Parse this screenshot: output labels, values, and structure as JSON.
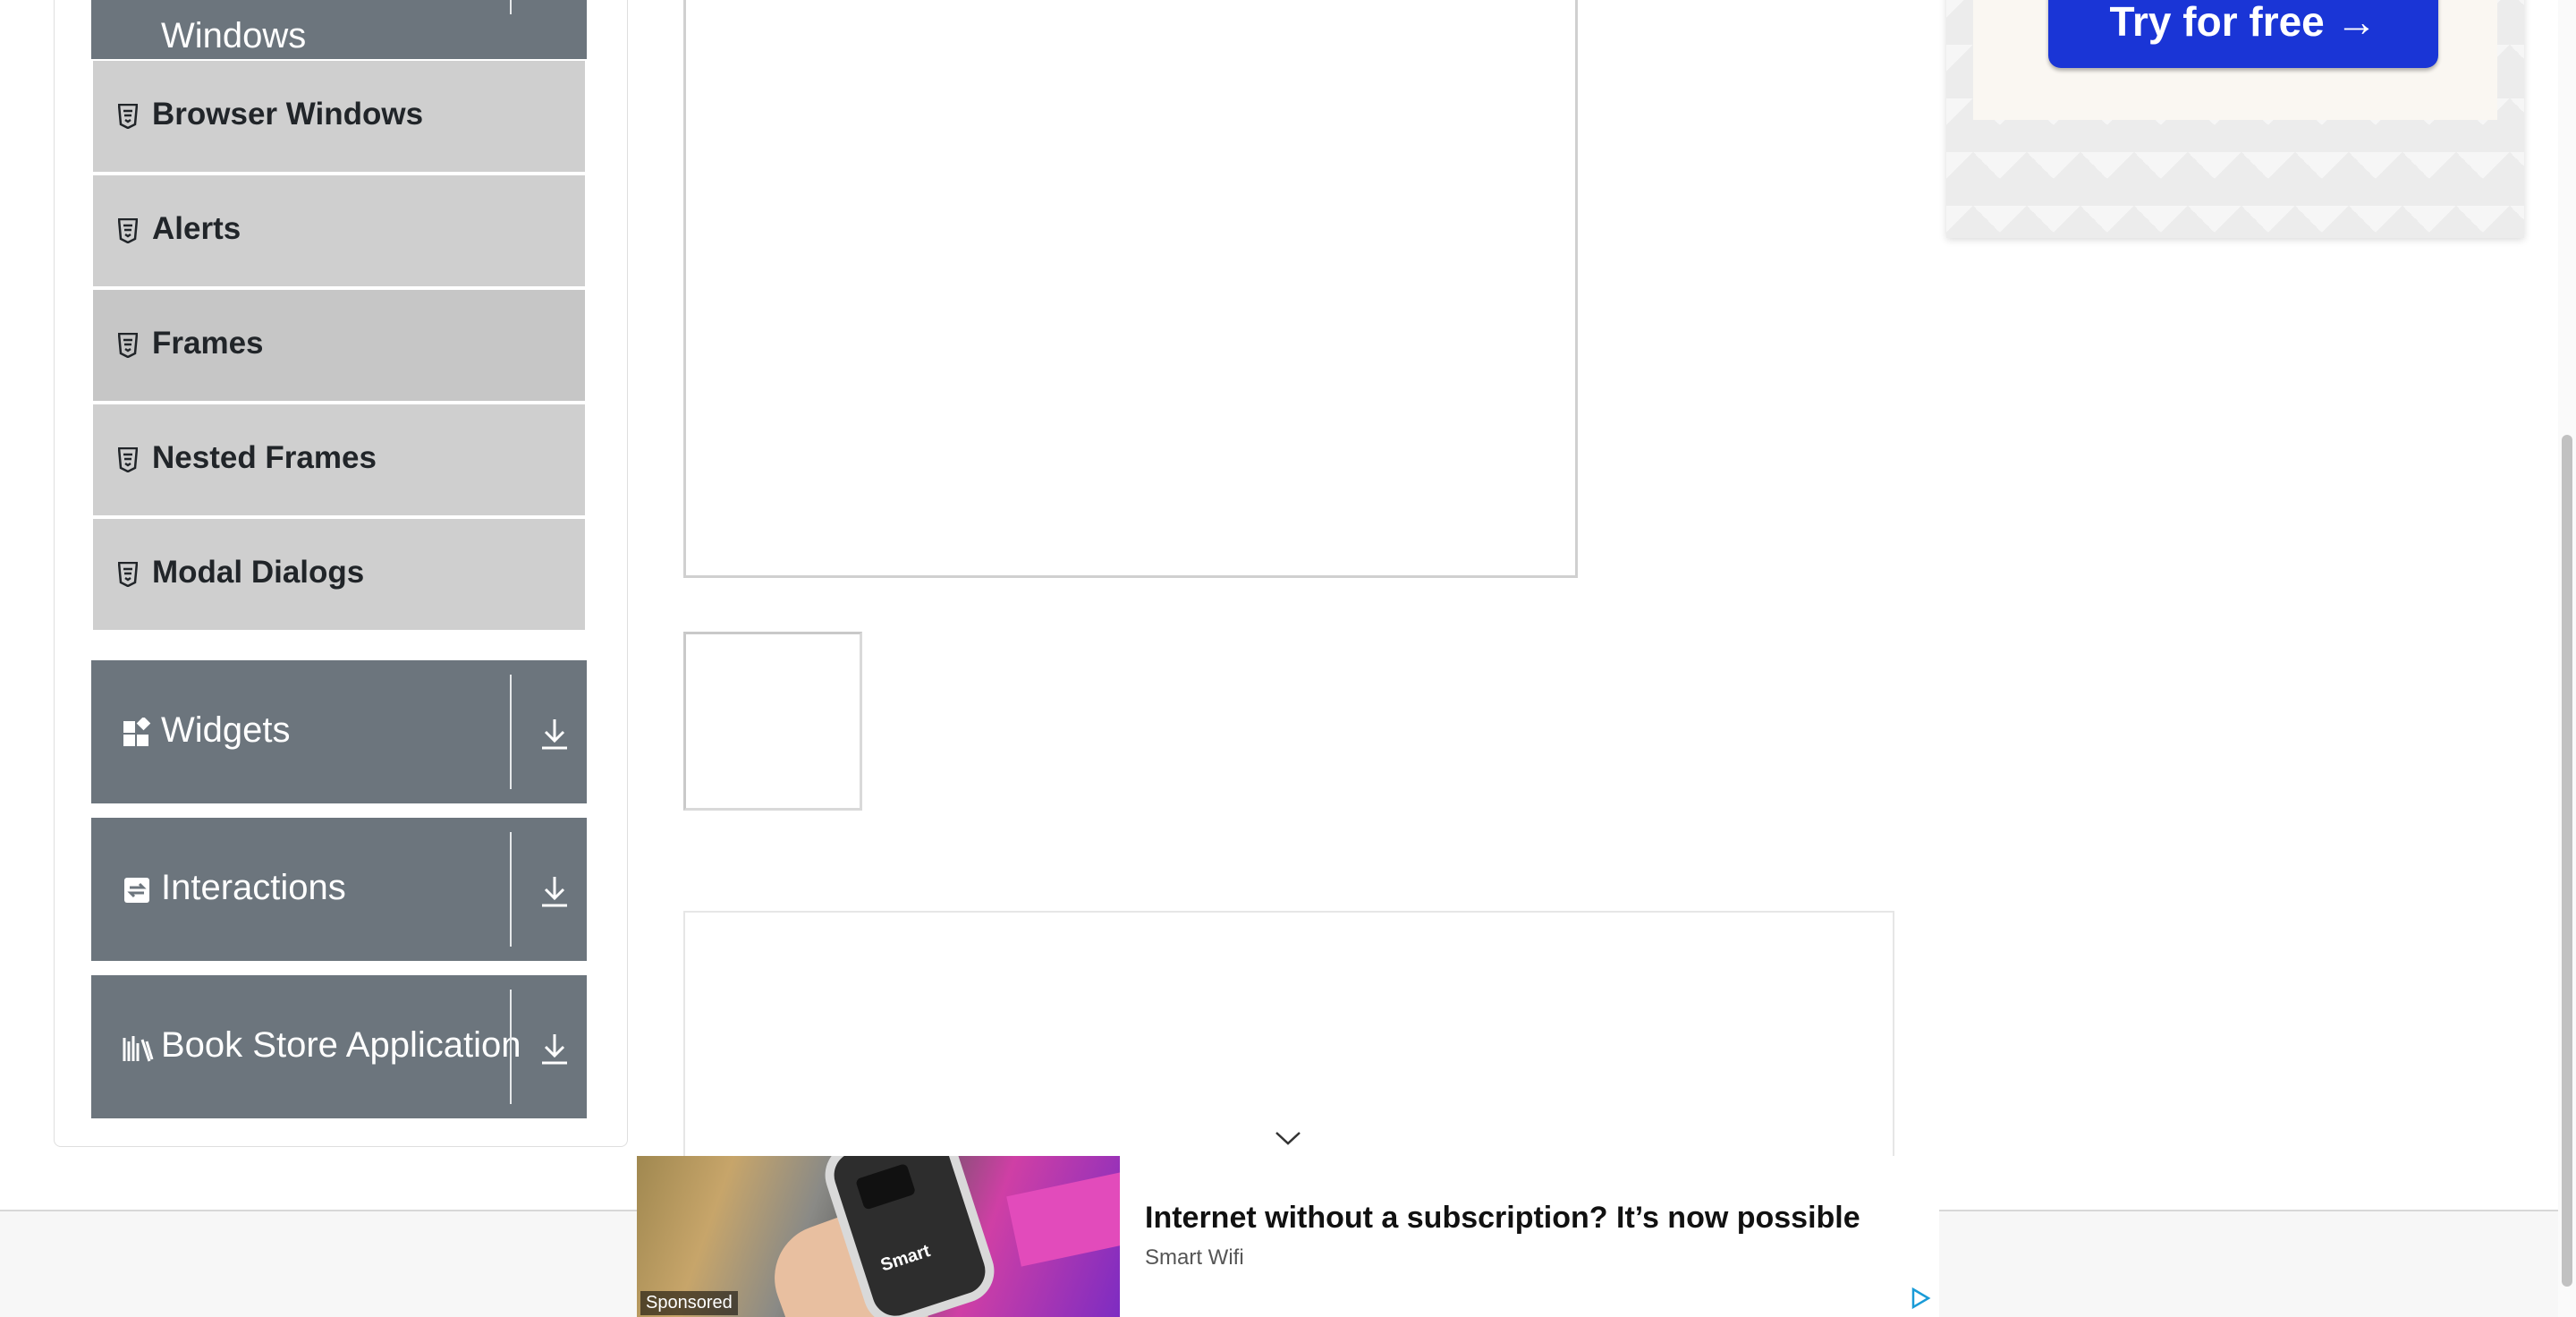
{
  "sidebar": {
    "top_group": {
      "label": "Windows"
    },
    "items": [
      {
        "label": "Browser Windows",
        "active": false
      },
      {
        "label": "Alerts",
        "active": false
      },
      {
        "label": "Frames",
        "active": true
      },
      {
        "label": "Nested Frames",
        "active": false
      },
      {
        "label": "Modal Dialogs",
        "active": false
      }
    ],
    "groups": [
      {
        "label": "Widgets",
        "icon": "widgets-icon"
      },
      {
        "label": "Interactions",
        "icon": "interactions-icon"
      },
      {
        "label": "Book Store Application",
        "icon": "books-icon"
      }
    ]
  },
  "ads": {
    "top": {
      "button_label": "Try for free →"
    },
    "bottom": {
      "title": "Internet without a subscription? It’s now possible",
      "source": "Smart Wifi",
      "sponsored": "Sponsored",
      "image_brand": "Smart"
    }
  },
  "colors": {
    "group_header": "#6c757d",
    "menu_item": "#cfcfcf",
    "ad_button": "#1a35d6"
  }
}
